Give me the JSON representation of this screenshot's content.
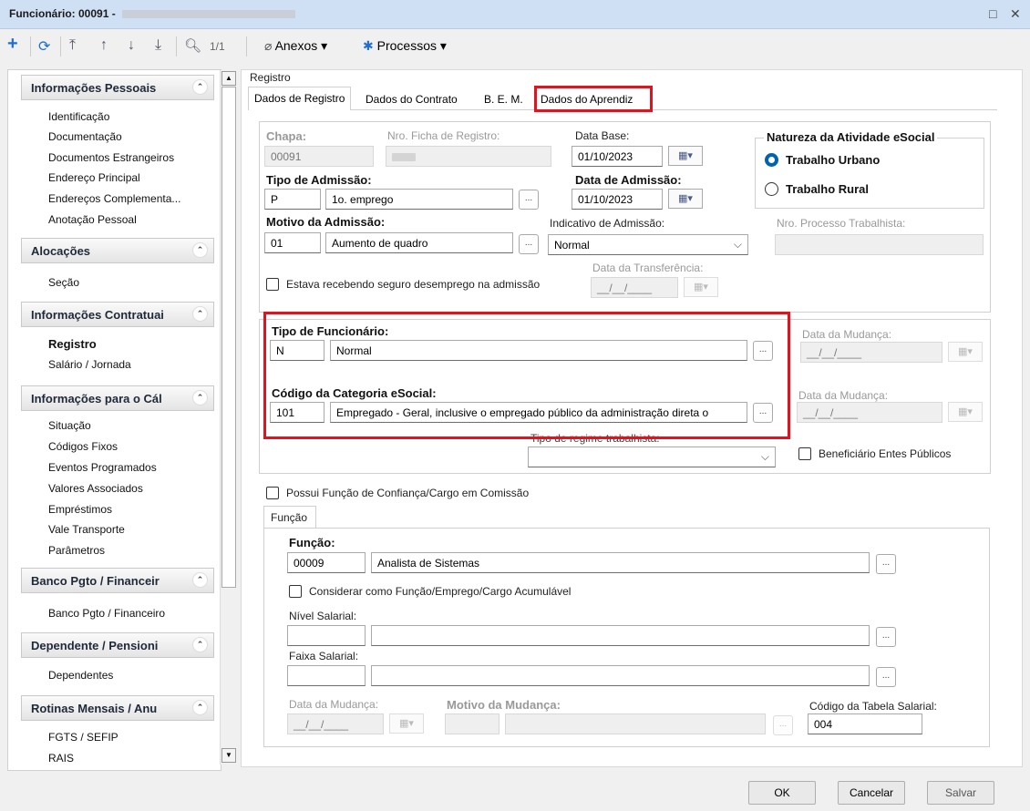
{
  "window": {
    "title": "Funcionário: 00091 - ",
    "restore_glyph": "□",
    "close_glyph": "✕"
  },
  "toolbar": {
    "page": "1/1",
    "anexos": "Anexos",
    "processos": "Processos"
  },
  "sidebar": {
    "groups": [
      {
        "title": "Informações Pessoais",
        "items": [
          "Identificação",
          "Documentação",
          "Documentos Estrangeiros",
          "Endereço Principal",
          "Endereços Complementa...",
          "Anotação Pessoal"
        ]
      },
      {
        "title": "Alocações",
        "items": [
          "Seção"
        ]
      },
      {
        "title": "Informações Contratuai",
        "items": [
          "Registro",
          "Salário / Jornada"
        ]
      },
      {
        "title": "Informações para o Cál",
        "items": [
          "Situação",
          "Códigos Fixos",
          "Eventos Programados",
          "Valores Associados",
          "Empréstimos",
          "Vale Transporte",
          "Parâmetros"
        ]
      },
      {
        "title": "Banco Pgto / Financeir",
        "items": [
          "Banco Pgto / Financeiro"
        ]
      },
      {
        "title": "Dependente / Pensioni",
        "items": [
          "Dependentes"
        ]
      },
      {
        "title": "Rotinas Mensais / Anu",
        "items": [
          "FGTS / SEFIP",
          "RAIS"
        ]
      }
    ]
  },
  "main": {
    "group_label": "Registro",
    "tabs": [
      "Dados de Registro",
      "Dados do Contrato",
      "B. E. M.",
      "Dados do Aprendiz"
    ],
    "chapa_label": "Chapa:",
    "chapa": "00091",
    "ficha_label": "Nro. Ficha de Registro:",
    "data_base_label": "Data Base:",
    "data_base": "01/10/2023",
    "natureza_label": "Natureza da Atividade eSocial",
    "radio_urbano": "Trabalho Urbano",
    "radio_rural": "Trabalho Rural",
    "tipo_adm_label": "Tipo de Admissão:",
    "tipo_adm_code": "P",
    "tipo_adm_desc": "1o. emprego",
    "data_adm_label": "Data de Admissão:",
    "data_adm": "01/10/2023",
    "motivo_label": "Motivo da Admissão:",
    "motivo_code": "01",
    "motivo_desc": "Aumento de quadro",
    "indicativo_label": "Indicativo de Admissão:",
    "indicativo_value": "Normal",
    "processo_label": "Nro. Processo Trabalhista:",
    "transferencia_label": "Data da Transferência:",
    "date_mask": "__/__/____",
    "seguro_label": "Estava recebendo seguro desemprego na admissão",
    "tipo_func_label": "Tipo de Funcionário:",
    "tipo_func_code": "N",
    "tipo_func_desc": "Normal",
    "data_mudanca_label": "Data da Mudança:",
    "categoria_label": "Código da Categoria eSocial:",
    "categoria_code": "101",
    "categoria_desc": "Empregado - Geral, inclusive o empregado público da administração direta o",
    "regime_label": "Tipo de regime trabalhista:",
    "beneficiario_label": "Beneficiário Entes Públicos",
    "confianca_label": "Possui Função de Confiança/Cargo em Comissão",
    "funcao_tab": "Função",
    "funcao_label": "Função:",
    "funcao_code": "00009",
    "funcao_desc": "Analista de Sistemas",
    "acumulavel_label": "Considerar como Função/Emprego/Cargo Acumulável",
    "nivel_label": "Nível Salarial:",
    "faixa_label": "Faixa Salarial:",
    "data_mudanca2_label": "Data da Mudança:",
    "motivo_mudanca_label": "Motivo da Mudança:",
    "tabela_label": "Código da Tabela Salarial:",
    "tabela_value": "004"
  },
  "buttons": {
    "ok": "OK",
    "cancel": "Cancelar",
    "save": "Salvar"
  },
  "colors": {
    "highlight": "#e0141e",
    "radio_accent": "#0063b1",
    "titlebar": "#cfe0f5"
  }
}
